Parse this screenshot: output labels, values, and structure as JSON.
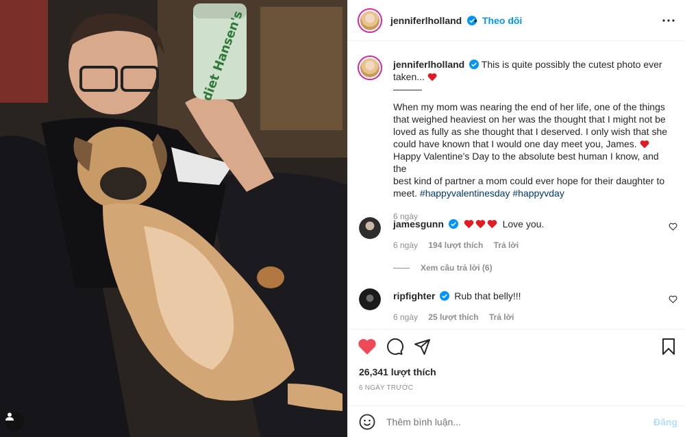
{
  "post": {
    "author": "jenniferlholland",
    "follow_label": "Theo dõi",
    "caption_line1": "This is quite possibly the cutest photo ever",
    "caption_line2": "taken...",
    "caption_divider": "———",
    "body_lines": [
      "When my mom was nearing the end of her life, one of the things",
      "that weighed heaviest on her was the thought that I might not be",
      "loved as fully as she thought that I deserved. I only wish that she",
      "could have known that I would one day meet you, James.",
      "Happy Valentine's Day to the absolute best human I know, and the",
      "best kind of partner a mom could ever hope for their daughter to"
    ],
    "body_last_prefix": "meet.",
    "hashtags": [
      "#happyvalentinesday",
      "#happyvday"
    ],
    "caption_time": "6 ngày",
    "likes": "26,341 lượt thích",
    "posted_ago": "6 NGÀY TRƯỚC",
    "product_label_can": "diet Hansen's"
  },
  "comments": [
    {
      "username": "jamesgunn",
      "text": "Love you.",
      "time": "6 ngày",
      "likes": "194 lượt thích",
      "reply": "Trả lời",
      "view_replies": "Xem câu trả lời (6)"
    },
    {
      "username": "ripfighter",
      "text": "Rub that belly!!!",
      "time": "6 ngày",
      "likes": "25 lượt thích",
      "reply": "Trả lời"
    }
  ],
  "comment_input": {
    "placeholder": "Thêm bình luận...",
    "post_label": "Đăng"
  },
  "colors": {
    "accent": "#0095f6",
    "like_red": "#ed4956",
    "hashtag": "#00376b",
    "muted": "#8e8e8e"
  },
  "icons": [
    "verified-badge-icon",
    "more-options-icon",
    "heart-icon",
    "comment-icon",
    "share-icon",
    "bookmark-icon",
    "emoji-icon",
    "user-tag-icon"
  ]
}
